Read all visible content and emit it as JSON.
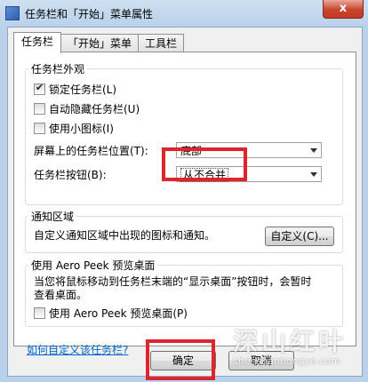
{
  "window": {
    "title": "任务栏和「开始」菜单属性",
    "close_glyph": "x"
  },
  "tabs": [
    {
      "label": "任务栏",
      "active": true
    },
    {
      "label": "「开始」菜单",
      "active": false
    },
    {
      "label": "工具栏",
      "active": false
    }
  ],
  "appearance": {
    "group_label": "任务栏外观",
    "lock_label": "锁定任务栏(L)",
    "lock_checked": true,
    "autohide_label": "自动隐藏任务栏(U)",
    "autohide_checked": false,
    "small_icons_label": "使用小图标(I)",
    "small_icons_checked": false,
    "location_label": "屏幕上的任务栏位置(T):",
    "location_value": "底部",
    "buttons_label": "任务栏按钮(B):",
    "buttons_value": "从不合并"
  },
  "notification": {
    "group_label": "通知区域",
    "text": "自定义通知区域中出现的图标和通知。",
    "customize_button": "自定义(C)..."
  },
  "aero": {
    "group_label": "使用 Aero Peek 预览桌面",
    "desc_line1": "当您将鼠标移动到任务栏末端的“显示桌面”按钮时，会暂时",
    "desc_line2": "查看桌面。",
    "checkbox_label": "使用 Aero Peek 预览桌面(P)",
    "checked": false
  },
  "help_link": "如何自定义该任务栏?",
  "buttons": {
    "ok": "确定",
    "cancel": "取消"
  },
  "watermark": {
    "main": "深山红叶",
    "sub": "shenshanhongye.com"
  },
  "highlight_color": "#e0232d"
}
